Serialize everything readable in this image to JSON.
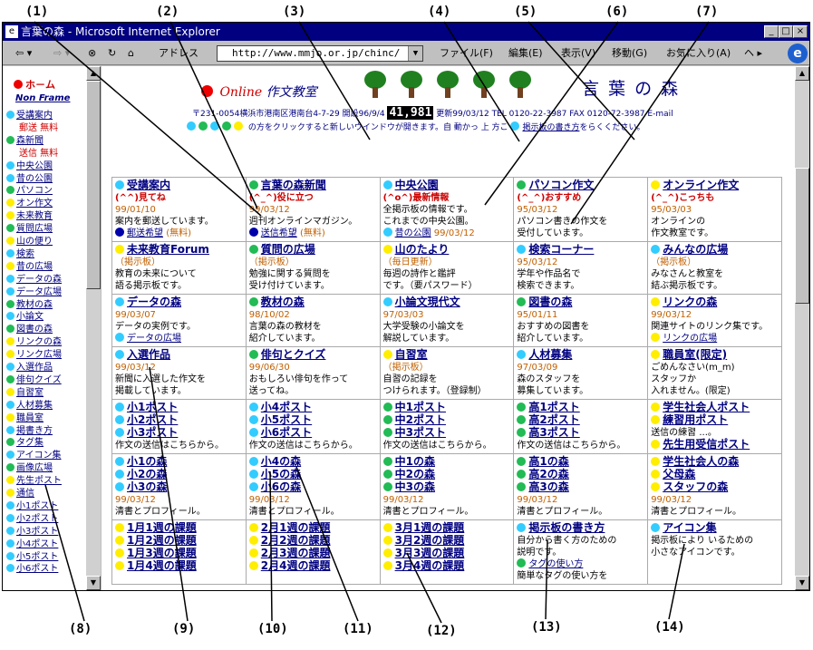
{
  "window": {
    "title": "言葉の森 - Microsoft Internet Explorer",
    "min": "_",
    "max": "□",
    "close": "×"
  },
  "toolbar": {
    "back": "⇦ ▾",
    "forward": "⇨ ▾",
    "address_label": "アドレス",
    "url": "http://www.mmjo.or.jp/chinc/",
    "menus": [
      "ファイル(F)",
      "編集(E)",
      "表示(V)",
      "移動(G)",
      "お気に入り(A)",
      "ヘ ▸"
    ]
  },
  "sidebar": {
    "home": "ホ－ム",
    "noframe": "Non Frame",
    "items": [
      {
        "label": "受講案内",
        "color": "#33ccff"
      },
      {
        "label": "郵送 無料",
        "color": "",
        "sub": true
      },
      {
        "label": "森新聞",
        "color": "#22bb55"
      },
      {
        "label": "送信 無料",
        "color": "",
        "sub": true
      },
      {
        "label": "中央公園",
        "color": "#33ccff"
      },
      {
        "label": "昔の公園",
        "color": "#33ccff"
      },
      {
        "label": "パソコン",
        "color": "#22bb55"
      },
      {
        "label": "オン作文",
        "color": "#ffee00"
      },
      {
        "label": "未来教育",
        "color": "#ffee00"
      },
      {
        "label": "質問広場",
        "color": "#22bb55"
      },
      {
        "label": "山の便り",
        "color": "#ffee00"
      },
      {
        "label": "検索",
        "color": "#33ccff"
      },
      {
        "label": "昔の広場",
        "color": "#ffee00"
      },
      {
        "label": "データの森",
        "color": "#33ccff"
      },
      {
        "label": "データ広場",
        "color": "#33ccff"
      },
      {
        "label": "教材の森",
        "color": "#22bb55"
      },
      {
        "label": "小論文",
        "color": "#33ccff"
      },
      {
        "label": "図書の森",
        "color": "#22bb55"
      },
      {
        "label": "リンクの森",
        "color": "#ffee00"
      },
      {
        "label": "リンク広場",
        "color": "#ffee00"
      },
      {
        "label": "入選作品",
        "color": "#33ccff"
      },
      {
        "label": "俳句クイズ",
        "color": "#22bb55"
      },
      {
        "label": "自習室",
        "color": "#ffee00"
      },
      {
        "label": "人材募集",
        "color": "#33ccff"
      },
      {
        "label": "職員室",
        "color": "#ffee00"
      },
      {
        "label": "掲書き方",
        "color": "#33ccff"
      },
      {
        "label": "タグ集",
        "color": "#22bb55"
      },
      {
        "label": "アイコン集",
        "color": "#33ccff"
      },
      {
        "label": "画像広場",
        "color": "#22bb55"
      },
      {
        "label": "先生ポスト",
        "color": "#ffee00"
      },
      {
        "label": "通信",
        "color": "#ffee00"
      },
      {
        "label": "小1ポスト",
        "color": "#33ccff"
      },
      {
        "label": "小2ポスト",
        "color": "#33ccff"
      },
      {
        "label": "小3ポスト",
        "color": "#33ccff"
      },
      {
        "label": "小4ポスト",
        "color": "#33ccff"
      },
      {
        "label": "小5ポスト",
        "color": "#33ccff"
      },
      {
        "label": "小6ポスト",
        "color": "#33ccff"
      }
    ]
  },
  "header": {
    "online": "Online",
    "title": "作文教室",
    "forest": "言 葉 の 森",
    "address": "〒231-0054横浜市港南区港南台4-7-29 開設96/9/4",
    "counter": "41,981",
    "contact": "更新99/03/12 TEL 0120-22-3987 FAX 0120-72-3987 E-mail",
    "notice": "の方をクリックすると新しいウインドウが開きます。自 動かっ 上 方こ",
    "notice_link": "掲示板の書き方",
    "notice_end": "をらくください。"
  },
  "cells": [
    [
      {
        "dot": "#33ccff",
        "title": "受講案内",
        "red": "(^^)見てね",
        "date": "99/01/10",
        "desc": "案内を郵送しています。",
        "link": "郵送希望",
        "tail": "(無料)",
        "linkdot": "#0000aa"
      },
      {
        "dot": "#22bb55",
        "title": "言葉の森新聞",
        "red": "(^_^)役に立つ",
        "date": "99/03/12",
        "desc": "週刊オンラインマガジン。",
        "link": "送信希望",
        "tail": "(無料)",
        "linkdot": "#0000aa"
      },
      {
        "dot": "#33ccff",
        "title": "中央公園",
        "red": "(^o^)最新情報",
        "date": "",
        "desc": "全掲示板の情報です。",
        "link": "昔の公園",
        "tail": "99/03/12",
        "linkdot": "#33ccff",
        "desc2": "これまでの中央公園。"
      },
      {
        "dot": "#22bb55",
        "title": "パソコン作文",
        "red": "(^_^)おすすめ",
        "date": "95/03/12",
        "desc": "パソコン書きの作文を",
        "desc2": "受付しています。"
      },
      {
        "dot": "#ffee00",
        "title": "オンライン作文",
        "red": "(^_^)こっちも",
        "date": "95/03/03",
        "desc": "オンラインの",
        "desc2": "作文教室です。"
      }
    ],
    [
      {
        "dot": "#ffee00",
        "title": "未来教育Forum",
        "org": "（掲示板）",
        "desc": "教育の未来について",
        "desc2": "語る掲示板です。"
      },
      {
        "dot": "#22bb55",
        "title": "質問の広場",
        "org": "（掲示板）",
        "desc": "勉強に関する質問を",
        "desc2": "受け付けています。"
      },
      {
        "dot": "#ffee00",
        "title": "山のたより",
        "org": "（毎日更新）",
        "desc": "毎週の詩作と鑑評",
        "desc2": "です。（要パスワード）"
      },
      {
        "dot": "#33ccff",
        "title": "検索コーナー",
        "date": "95/03/12",
        "desc": "学年や作品名で",
        "desc2": "検索できます。"
      },
      {
        "dot": "#33ccff",
        "title": "みんなの広場",
        "org": "（掲示板）",
        "desc": "みなさんと教室を",
        "desc2": "結ぶ掲示板です。"
      }
    ],
    [
      {
        "dot": "#33ccff",
        "title": "データの森",
        "date": "99/03/07",
        "link": "データの広場",
        "linkdot": "#33ccff",
        "desc": "データの実例です。"
      },
      {
        "dot": "#22bb55",
        "title": "教材の森",
        "date": "98/10/02",
        "desc": "言葉の森の教材を",
        "desc2": "紹介しています。"
      },
      {
        "dot": "#33ccff",
        "title": "小論文現代文",
        "date": "97/03/03",
        "desc": "大学受験の小論文を",
        "desc2": "解説しています。"
      },
      {
        "dot": "#22bb55",
        "title": "図書の森",
        "date": "95/01/11",
        "desc": "おすすめの図書を",
        "desc2": "紹介しています。"
      },
      {
        "dot": "#ffee00",
        "title": "リンクの森",
        "date": "99/03/12",
        "desc": "関連サイトのリンク集です。",
        "link": "リンクの広場",
        "linkdot": "#ffee00"
      }
    ],
    [
      {
        "dot": "#33ccff",
        "title": "入選作品",
        "date": "99/03/12",
        "desc": "新聞に入選した作文を",
        "desc2": "掲載しています。"
      },
      {
        "dot": "#22bb55",
        "title": "俳句とクイズ",
        "date": "99/06/30",
        "desc": "おもしろい俳句を作って",
        "desc2": "送ってね。"
      },
      {
        "dot": "#ffee00",
        "title": "自習室",
        "org": "（掲示板）",
        "desc": "自習の記録を",
        "desc2": "つけられます。（登録制）"
      },
      {
        "dot": "#33ccff",
        "title": "人材募集",
        "date": "97/03/09",
        "desc": "森のスタッフを",
        "desc2": "募集しています。"
      },
      {
        "dot": "#ffee00",
        "title": "職員室(限定)",
        "desc": "ごめんなさい(m_m)",
        "desc2": "スタッフか",
        "desc3": "入れません。(限定)"
      }
    ],
    [
      {
        "list": [
          {
            "d": "#33ccff",
            "t": "小1ポスト"
          },
          {
            "d": "#33ccff",
            "t": "小2ポスト"
          },
          {
            "d": "#33ccff",
            "t": "小3ポスト"
          }
        ],
        "desc": "作文の送信はこちらから。"
      },
      {
        "list": [
          {
            "d": "#33ccff",
            "t": "小4ポスト"
          },
          {
            "d": "#33ccff",
            "t": "小5ポスト"
          },
          {
            "d": "#33ccff",
            "t": "小6ポスト"
          }
        ],
        "desc": "作文の送信はこちらから。"
      },
      {
        "list": [
          {
            "d": "#22bb55",
            "t": "中1ポスト"
          },
          {
            "d": "#22bb55",
            "t": "中2ポスト"
          },
          {
            "d": "#22bb55",
            "t": "中3ポスト"
          }
        ],
        "desc": "作文の送信はこちらから。"
      },
      {
        "list": [
          {
            "d": "#22bb55",
            "t": "高1ポスト"
          },
          {
            "d": "#22bb55",
            "t": "高2ポスト"
          },
          {
            "d": "#22bb55",
            "t": "高3ポスト"
          }
        ],
        "desc": "作文の送信はこちらから。"
      },
      {
        "list": [
          {
            "d": "#ffee00",
            "t": "学生社会人ポスト"
          },
          {
            "d": "#ffee00",
            "t": "練習用ポスト"
          }
        ],
        "desc": "送信の練習 ...。",
        "list2": [
          {
            "d": "#ffee00",
            "t": "先生用受信ポスト"
          }
        ]
      }
    ],
    [
      {
        "list": [
          {
            "d": "#33ccff",
            "t": "小1の森"
          },
          {
            "d": "#33ccff",
            "t": "小2の森"
          },
          {
            "d": "#33ccff",
            "t": "小3の森"
          }
        ],
        "date": "99/03/12",
        "desc": "清書とプロフィール。"
      },
      {
        "list": [
          {
            "d": "#33ccff",
            "t": "小4の森"
          },
          {
            "d": "#33ccff",
            "t": "小5の森"
          },
          {
            "d": "#33ccff",
            "t": "小6の森"
          }
        ],
        "date": "99/03/12",
        "desc": "清書とプロフィール。"
      },
      {
        "list": [
          {
            "d": "#22bb55",
            "t": "中1の森"
          },
          {
            "d": "#22bb55",
            "t": "中2の森"
          },
          {
            "d": "#22bb55",
            "t": "中3の森"
          }
        ],
        "date": "99/03/12",
        "desc": "清書とプロフィール。"
      },
      {
        "list": [
          {
            "d": "#22bb55",
            "t": "高1の森"
          },
          {
            "d": "#22bb55",
            "t": "高2の森"
          },
          {
            "d": "#22bb55",
            "t": "高3の森"
          }
        ],
        "date": "99/03/12",
        "desc": "清書とプロフィール。"
      },
      {
        "list": [
          {
            "d": "#ffee00",
            "t": "学生社会人の森"
          },
          {
            "d": "#ffee00",
            "t": "父母森"
          },
          {
            "d": "#ffee00",
            "t": "スタッフの森"
          }
        ],
        "date": "99/03/12",
        "desc": "清書とプロフィール。"
      }
    ],
    [
      {
        "list": [
          {
            "d": "#ffee00",
            "t": "1月1週の課題"
          },
          {
            "d": "#ffee00",
            "t": "1月2週の課題"
          },
          {
            "d": "#ffee00",
            "t": "1月3週の課題"
          },
          {
            "d": "#ffee00",
            "t": "1月4週の課題"
          }
        ]
      },
      {
        "list": [
          {
            "d": "#ffee00",
            "t": "2月1週の課題"
          },
          {
            "d": "#ffee00",
            "t": "2月2週の課題"
          },
          {
            "d": "#ffee00",
            "t": "2月3週の課題"
          },
          {
            "d": "#ffee00",
            "t": "2月4週の課題"
          }
        ]
      },
      {
        "list": [
          {
            "d": "#ffee00",
            "t": "3月1週の課題"
          },
          {
            "d": "#ffee00",
            "t": "3月2週の課題"
          },
          {
            "d": "#ffee00",
            "t": "3月3週の課題"
          },
          {
            "d": "#ffee00",
            "t": "3月4週の課題"
          }
        ]
      },
      {
        "dot": "#33ccff",
        "title": "掲示板の書き方",
        "desc": "自分から書く方のための",
        "desc2": "説明です。",
        "link": "タグの使い方",
        "linkdot": "#22bb55",
        "desc3": "簡単なタグの使い方を"
      },
      {
        "dot": "#33ccff",
        "title": "アイコン集",
        "desc": "掲示板により いるための",
        "desc2": "小さなアイコンです。"
      }
    ]
  ],
  "callouts": [
    "(1)",
    "(2)",
    "(3)",
    "(4)",
    "(5)",
    "(6)",
    "(7)",
    "(8)",
    "(9)",
    "(10)",
    "(11)",
    "(12)",
    "(13)",
    "(14)"
  ]
}
